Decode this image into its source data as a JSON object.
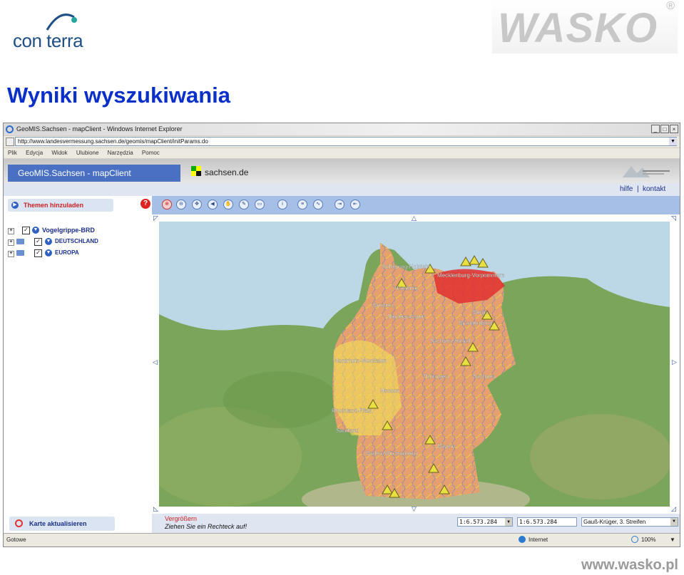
{
  "slide": {
    "logo_left": "con terra",
    "logo_right": "WASKO",
    "logo_right_mark": "®",
    "title": "Wyniki wyszukiwania",
    "footer_url": "www.wasko.pl"
  },
  "browser": {
    "window_title": "GeoMIS.Sachsen - mapClient - Windows Internet Explorer",
    "address": "http://www.landesvermessung.sachsen.de/geomis/mapClient/initParams.do",
    "menu": [
      "Plik",
      "Edycja",
      "Widok",
      "Ulubione",
      "Narzędzia",
      "Pomoc"
    ],
    "window_buttons": [
      "_",
      "□",
      "×"
    ],
    "status_left": "Gotowe",
    "status_zone": "Internet",
    "zoom": "100%"
  },
  "app": {
    "tab_title": "GeoMIS.Sachsen - mapClient",
    "site": "sachsen.de",
    "links": {
      "help": "hilfe",
      "sep": "|",
      "contact": "kontakt"
    },
    "themen_button": "Themen hinzuladen",
    "help_icon": "?",
    "layers": [
      {
        "label": "Vogelgrippe-BRD",
        "checked": true
      },
      {
        "label": "Deutschland",
        "checked": true
      },
      {
        "label": "Europa",
        "checked": true
      }
    ],
    "refresh_button": "Karte aktualisieren",
    "tools": [
      "zoom-in-icon",
      "zoom-out-icon",
      "pan-icon",
      "back-icon",
      "hand-icon",
      "measure-icon",
      "print-icon",
      "info-icon",
      "list-icon",
      "chart-icon",
      "export-icon",
      "import-icon"
    ],
    "status": {
      "mode": "Vergrößern",
      "hint": "Ziehen Sie ein Rechteck auf!",
      "scale1": "1:6.573.284",
      "scale2": "1:6.573.284",
      "projection": "Gauß-Krüger, 3. Streifen"
    },
    "map_labels": [
      "Schleswig-Holstein",
      "Mecklenburg-Vorpommern",
      "Hamburg",
      "Bremen",
      "Niedersachsen",
      "Berlin",
      "Brandenburg",
      "Sachsen-Anhalt",
      "Nordrhein-Westfalen",
      "Thüringen",
      "Sachsen",
      "Hessen",
      "Rheinland-Pfalz",
      "Saarland",
      "Bayern",
      "Baden-Württemberg"
    ]
  },
  "colors": {
    "title_blue": "#0b2fc9",
    "tab_blue": "#4a70c4",
    "toolbar": "#a6bfe6",
    "sea": "#bcd8e6",
    "alert_red": "#e03030"
  }
}
